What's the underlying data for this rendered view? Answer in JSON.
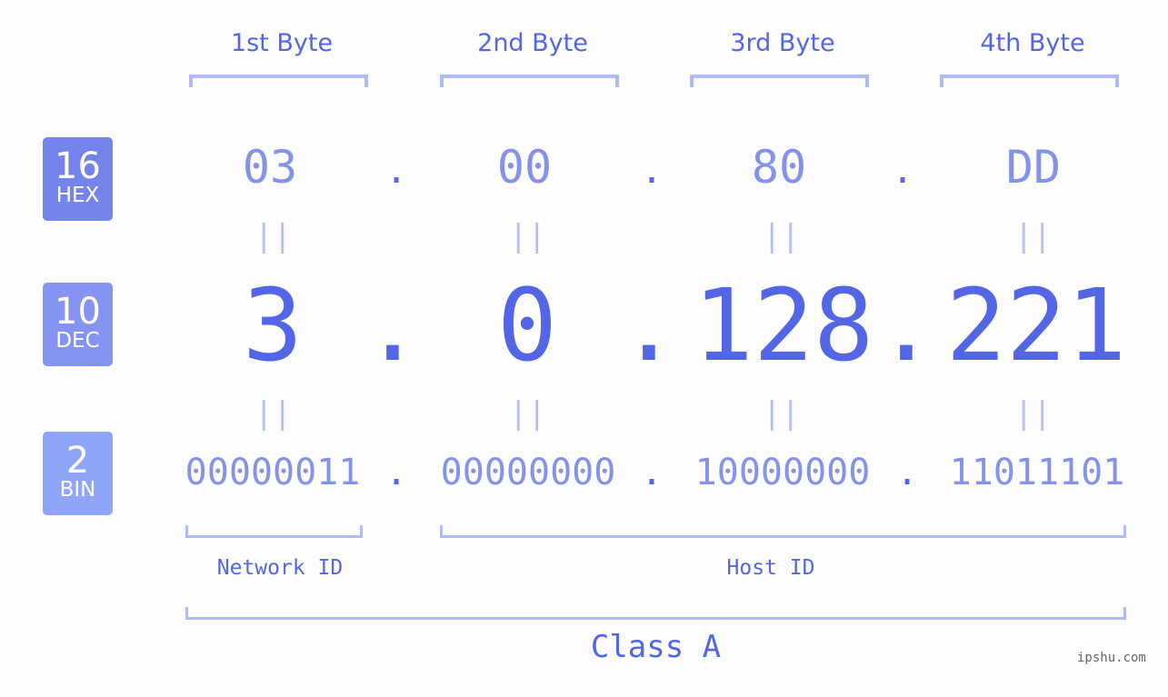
{
  "bytes": [
    {
      "label": "1st Byte",
      "hex": "03",
      "dec": "3",
      "bin": "00000011"
    },
    {
      "label": "2nd Byte",
      "hex": "00",
      "dec": "0",
      "bin": "00000000"
    },
    {
      "label": "3rd Byte",
      "hex": "80",
      "dec": "128",
      "bin": "10000000"
    },
    {
      "label": "4th Byte",
      "hex": "DD",
      "dec": "221",
      "bin": "11011101"
    }
  ],
  "badges": {
    "hex": {
      "num": "16",
      "label": "HEX",
      "color": "#7484ea"
    },
    "dec": {
      "num": "10",
      "label": "DEC",
      "color": "#8594f0"
    },
    "bin": {
      "num": "2",
      "label": "BIN",
      "color": "#8fa6f8"
    }
  },
  "separator": ".",
  "equals": "||",
  "network_label": "Network ID",
  "host_label": "Host ID",
  "class_label": "Class A",
  "watermark": "ipshu.com",
  "colors": {
    "accent": "#5266e6",
    "light": "#8592ea",
    "bracket": "#b0baf5"
  }
}
